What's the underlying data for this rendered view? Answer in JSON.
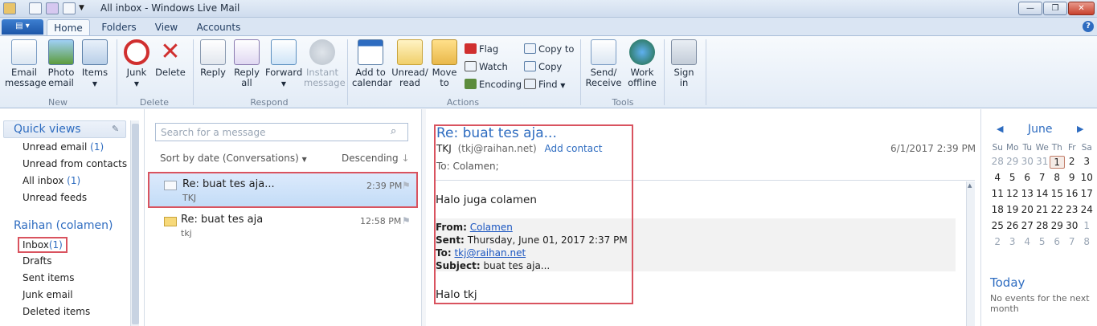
{
  "window": {
    "title": "All inbox - Windows Live Mail",
    "minimize": "—",
    "restore": "❐",
    "close": "✕"
  },
  "tabs": [
    {
      "label": "Home"
    },
    {
      "label": "Folders"
    },
    {
      "label": "View"
    },
    {
      "label": "Accounts"
    }
  ],
  "help_label": "?",
  "ribbon": {
    "new": {
      "group": "New",
      "email_message": "Email\nmessage",
      "photo_email": "Photo\nemail",
      "items": "Items"
    },
    "delete": {
      "group": "Delete",
      "junk": "Junk",
      "delete": "Delete"
    },
    "respond": {
      "group": "Respond",
      "reply": "Reply",
      "reply_all": "Reply\nall",
      "forward": "Forward",
      "instant_message": "Instant\nmessage"
    },
    "actions": {
      "group": "Actions",
      "add_to_calendar": "Add to\ncalendar",
      "unread_read": "Unread/\nread",
      "move_to": "Move\nto",
      "flag": "Flag",
      "watch": "Watch",
      "encoding": "Encoding",
      "copy_to": "Copy to",
      "copy": "Copy",
      "find": "Find"
    },
    "tools": {
      "group": "Tools",
      "send_receive": "Send/\nReceive",
      "work_offline": "Work\noffline",
      "sign_in": "Sign\nin"
    }
  },
  "nav": {
    "quick_views_title": "Quick views",
    "quick_views": [
      {
        "label": "Unread email",
        "count": "(1)"
      },
      {
        "label": "Unread from contacts",
        "count": ""
      },
      {
        "label": "All inbox",
        "count": "(1)"
      },
      {
        "label": "Unread feeds",
        "count": ""
      }
    ],
    "account_title": "Raihan (colamen)",
    "folders": [
      {
        "label": "Inbox",
        "count": "(1)"
      },
      {
        "label": "Drafts"
      },
      {
        "label": "Sent items"
      },
      {
        "label": "Junk email"
      },
      {
        "label": "Deleted items"
      }
    ]
  },
  "message_list": {
    "search_placeholder": "Search for a message",
    "sort_label": "Sort by date (Conversations)",
    "order_label": "Descending",
    "messages": [
      {
        "subject": "Re: buat tes aja...",
        "from": "TKJ",
        "time": "2:39 PM"
      },
      {
        "subject": "Re: buat tes aja",
        "from": "tkj",
        "time": "12:58 PM"
      }
    ]
  },
  "reading_pane": {
    "subject": "Re: buat tes aja...",
    "sender_name": "TKJ",
    "sender_email": "(tkj@raihan.net)",
    "add_contact": "Add contact",
    "date": "6/1/2017 2:39 PM",
    "to_line": "To:  Colamen;",
    "greeting": "Halo juga colamen",
    "quote": {
      "from_label": "From:",
      "from_value": "Colamen",
      "sent_label": "Sent:",
      "sent_value": "Thursday, June 01, 2017 2:37 PM",
      "to_label": "To:",
      "to_value": "tkj@raihan.net",
      "subject_label": "Subject:",
      "subject_value": "buat tes aja..."
    },
    "closing": "Halo tkj"
  },
  "calendar": {
    "month": "June",
    "weekdays": [
      "Su",
      "Mo",
      "Tu",
      "We",
      "Th",
      "Fr",
      "Sa"
    ],
    "weeks": [
      [
        "28",
        "29",
        "30",
        "31",
        "1",
        "2",
        "3"
      ],
      [
        "4",
        "5",
        "6",
        "7",
        "8",
        "9",
        "10"
      ],
      [
        "11",
        "12",
        "13",
        "14",
        "15",
        "16",
        "17"
      ],
      [
        "18",
        "19",
        "20",
        "21",
        "22",
        "23",
        "24"
      ],
      [
        "25",
        "26",
        "27",
        "28",
        "29",
        "30",
        "1"
      ],
      [
        "2",
        "3",
        "4",
        "5",
        "6",
        "7",
        "8"
      ]
    ],
    "today_title": "Today",
    "today_text": "No events for the next month"
  },
  "colors": {
    "accent": "#2e6cc0",
    "highlight_border": "#d9535f"
  }
}
